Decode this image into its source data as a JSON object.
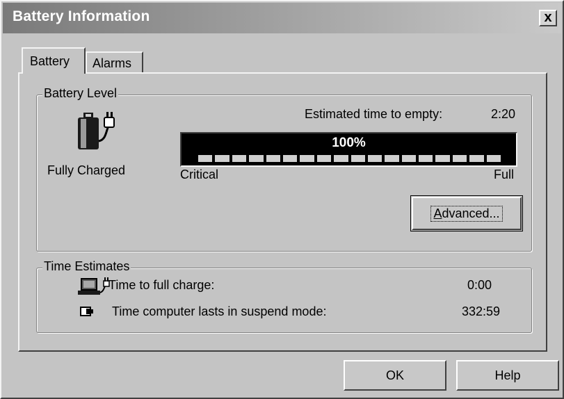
{
  "window": {
    "title": "Battery Information",
    "close_label": "x"
  },
  "tabs": [
    {
      "label": "Battery"
    },
    {
      "label": "Alarms"
    }
  ],
  "battery_level": {
    "group_label": "Battery Level",
    "status": "Fully Charged",
    "estimated_label": "Estimated time to empty:",
    "estimated_value": "2:20",
    "percent_label": "100%",
    "percent": 100,
    "segments": 18,
    "min_label": "Critical",
    "max_label": "Full",
    "advanced_label_first": "A",
    "advanced_label_rest": "dvanced..."
  },
  "time_estimates": {
    "group_label": "Time Estimates",
    "full_charge_label": "Time to full charge:",
    "full_charge_value": "0:00",
    "suspend_label": "Time computer lasts in suspend mode:",
    "suspend_value": "332:59"
  },
  "footer": {
    "ok_label": "OK",
    "help_label": "Help"
  },
  "icons": [
    "battery-plug-icon",
    "laptop-plug-icon",
    "suspend-battery-icon"
  ]
}
